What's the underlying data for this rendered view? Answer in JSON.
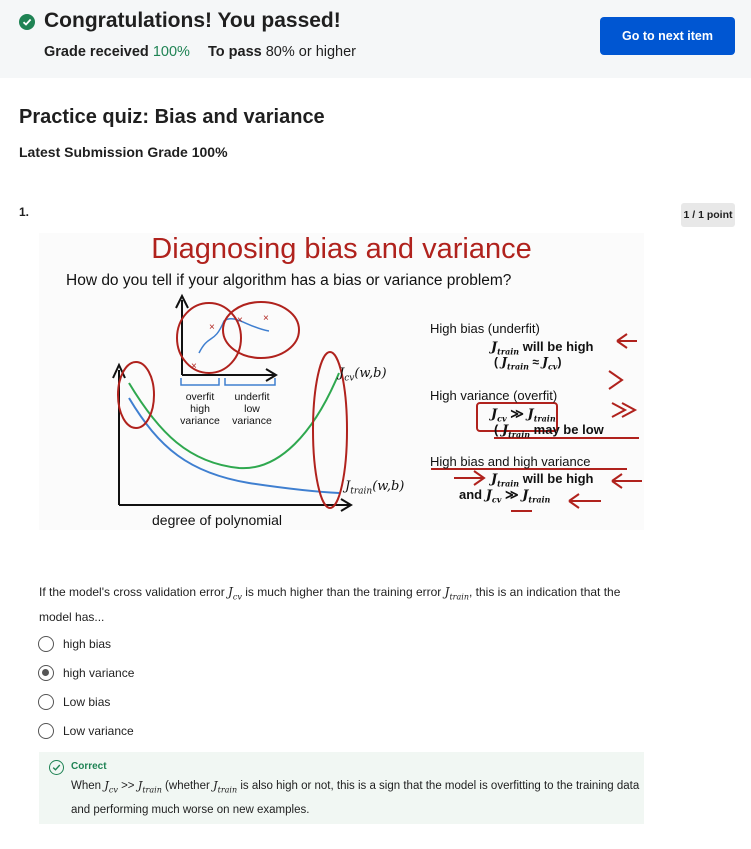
{
  "banner": {
    "title": "Congratulations! You passed!",
    "grade_label": "Grade received",
    "grade_value": "100%",
    "pass_label": "To pass",
    "pass_value": "80% or higher",
    "next_button": "Go to next item"
  },
  "quiz": {
    "title": "Practice quiz: Bias and variance",
    "latest_grade": "Latest Submission Grade 100%"
  },
  "question": {
    "number": "1.",
    "points": "1 / 1 point",
    "text_before": "If the model's cross validation error ",
    "jcv": "J",
    "jcv_sub": "cv",
    "text_mid": " is much higher than the training error ",
    "jtrain": "J",
    "jtrain_sub": "train",
    "text_after": ", this is an indication that the model has...",
    "options": [
      {
        "label": "high bias",
        "selected": false
      },
      {
        "label": "high variance",
        "selected": true
      },
      {
        "label": "Low bias",
        "selected": false
      },
      {
        "label": "Low variance",
        "selected": false
      }
    ]
  },
  "slide": {
    "title": "Diagnosing bias and variance",
    "subtitle": "How do you tell if your algorithm has a bias or variance problem?",
    "x_label": "degree of polynomial",
    "overfit_label": "overfit\nhigh\nvariance",
    "underfit_label": "underfit\nlow\nvariance",
    "curve_cv": "J_cv(w,b)",
    "curve_train": "J_train(w,b)",
    "high_bias": "High bias (underfit)",
    "high_bias_1": "J_train will be high",
    "high_bias_2": "(J_train ≈ J_cv)",
    "high_var": "High variance (overfit)",
    "high_var_1": "J_cv ≫ J_train",
    "high_var_2": "(J_train may be low)",
    "both": "High bias and high variance",
    "both_1": "J_train will be high",
    "both_2": "and J_cv ≫ J_train"
  },
  "feedback": {
    "title": "Correct",
    "text_before": "When ",
    "text_mid": " >> ",
    "text_mid2": " (whether ",
    "text_after": " is also high or not, this is a sign that the model is overfitting to the training data and performing much worse on new examples."
  },
  "colors": {
    "success": "#1f8354",
    "primary": "#0056d2",
    "slide_red": "#b0221d",
    "cv_curve": "#2fa84f",
    "train_curve": "#3f7fd0"
  }
}
